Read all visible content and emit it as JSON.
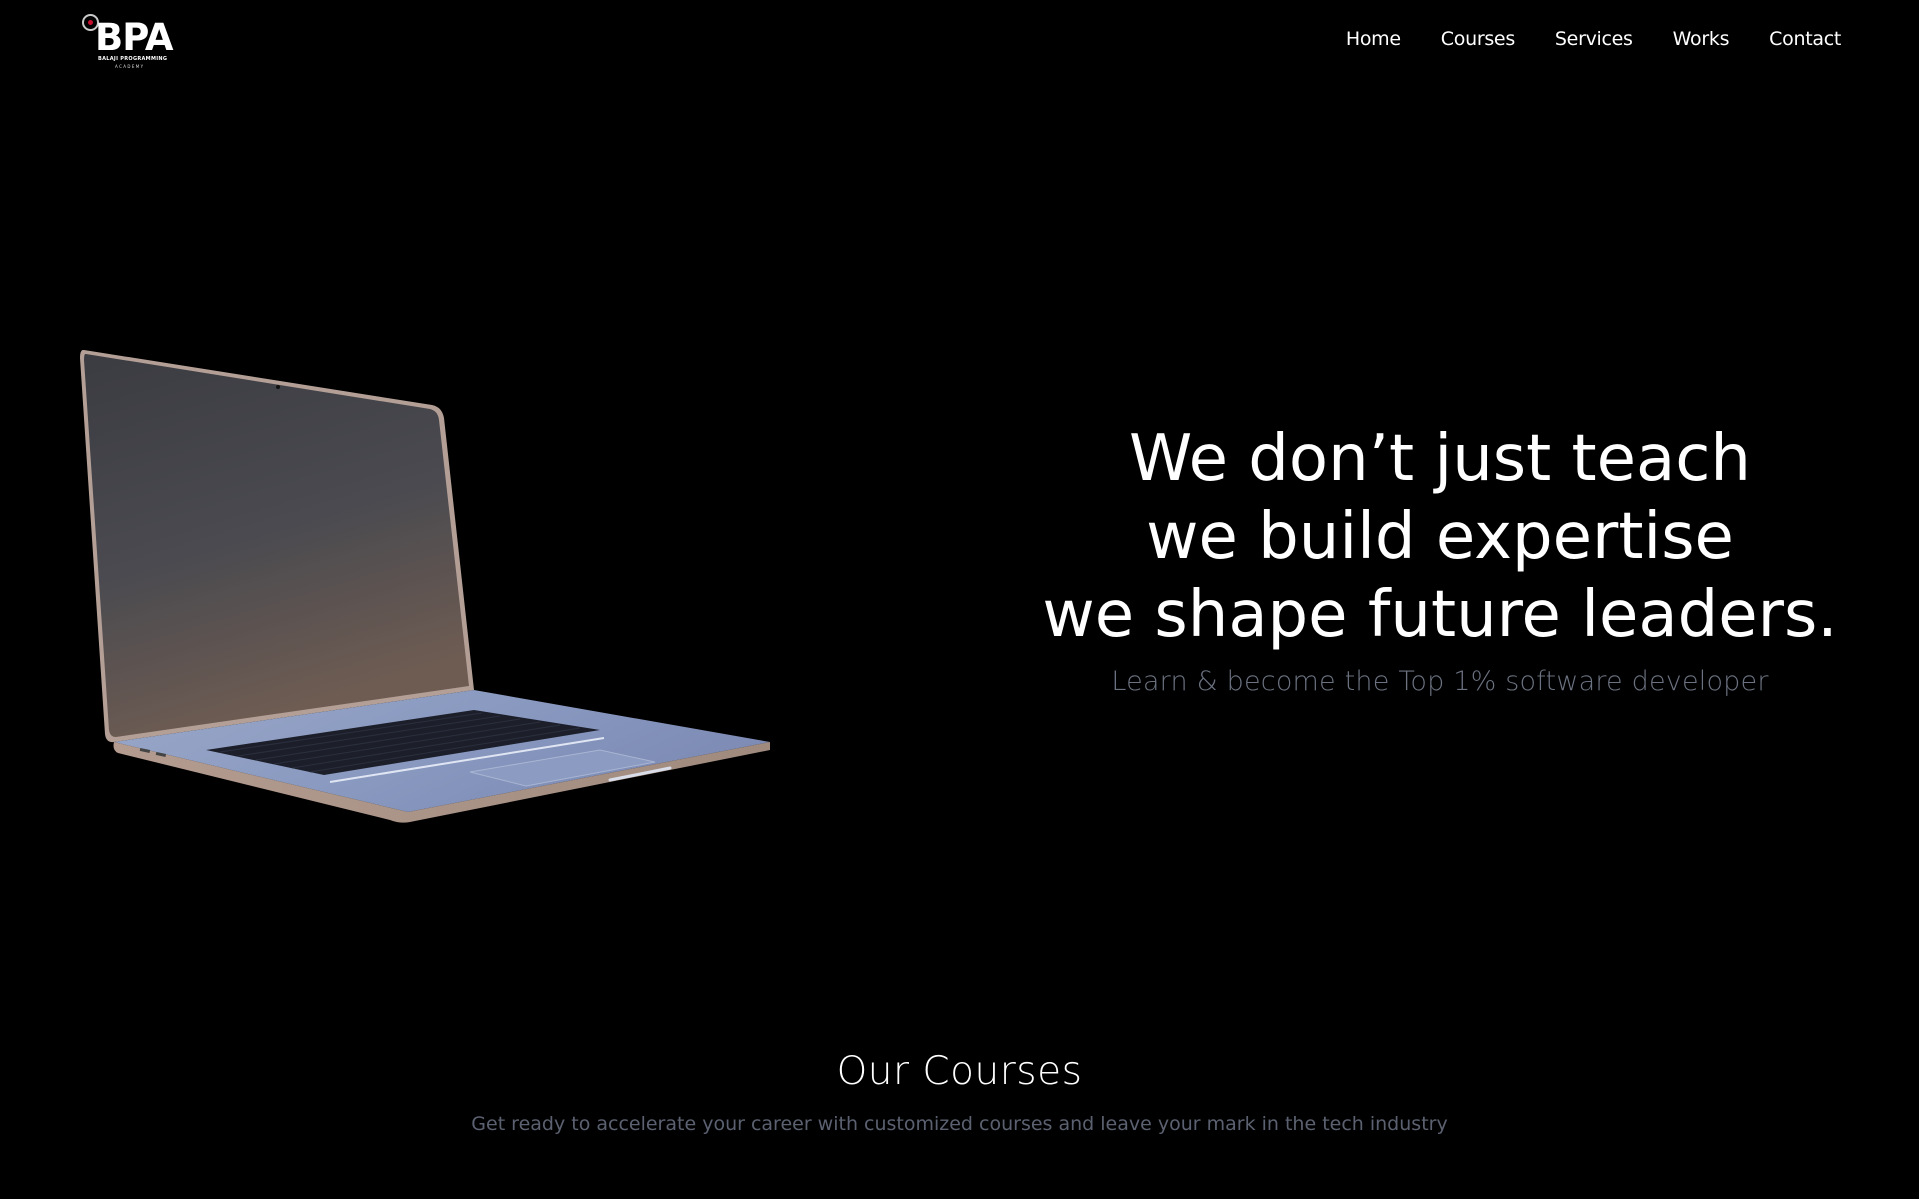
{
  "brand": {
    "logo_text": "BPA",
    "logo_subtitle": "BALAJI PROGRAMMING",
    "logo_subtitle2": "ACADEMY"
  },
  "nav": {
    "items": [
      {
        "label": "Home"
      },
      {
        "label": "Courses"
      },
      {
        "label": "Services"
      },
      {
        "label": "Works"
      },
      {
        "label": "Contact"
      }
    ]
  },
  "hero": {
    "headline_lines": [
      "We don’t just teach",
      "we build expertise",
      "we shape future leaders."
    ],
    "tagline": "Learn & become the Top 1% software developer",
    "image": "laptop-3d-render"
  },
  "courses": {
    "title": "Our Courses",
    "subtitle": "Get ready to accelerate your career with customized courses and leave your mark in the tech industry"
  },
  "colors": {
    "background": "#000000",
    "text": "#ffffff",
    "muted": "#6b7280",
    "logo_accent": "#c8102e"
  }
}
